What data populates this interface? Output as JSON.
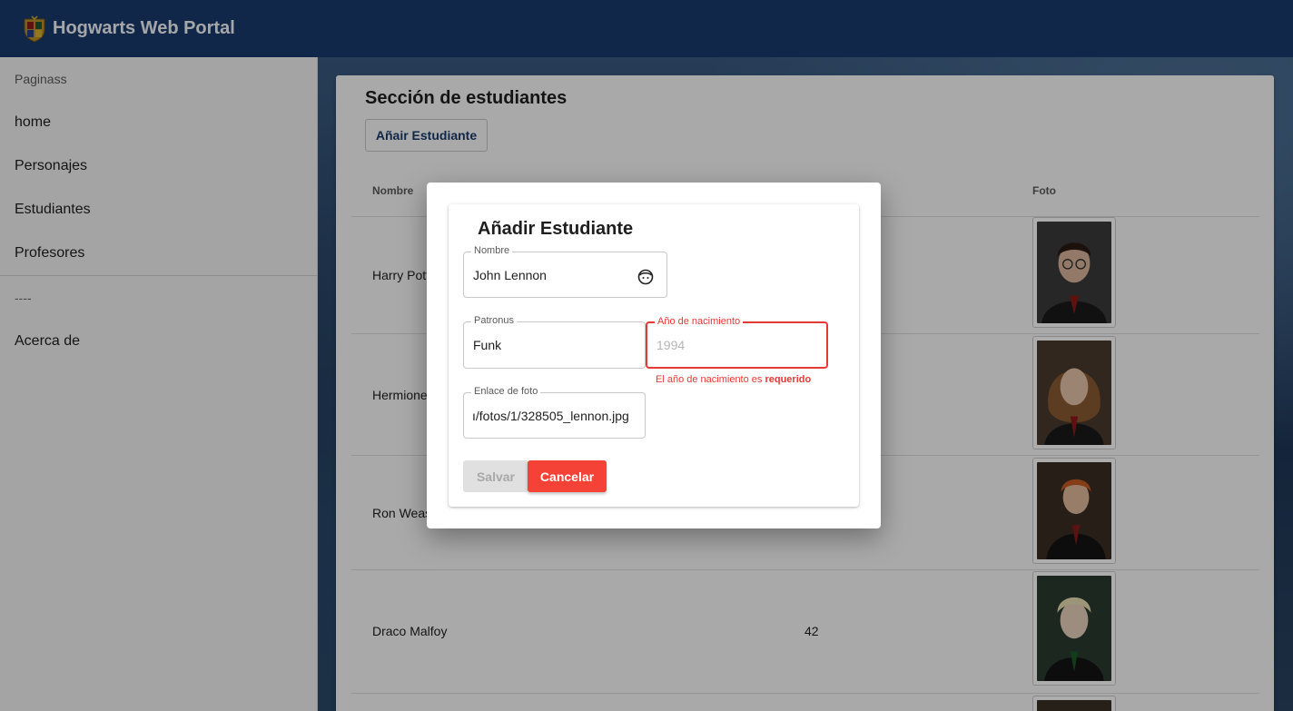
{
  "app": {
    "title": "Hogwarts Web Portal"
  },
  "sidebar": {
    "header": "Paginass",
    "items": [
      {
        "label": "home"
      },
      {
        "label": "Personajes"
      },
      {
        "label": "Estudiantes"
      },
      {
        "label": "Profesores"
      }
    ],
    "separator_text": "----",
    "about": "Acerca de"
  },
  "main": {
    "section_title": "Sección de estudiantes",
    "add_button": "Añair Estudiante",
    "columns": {
      "name": "Nombre",
      "photo": "Foto"
    },
    "rows": [
      {
        "name": "Harry Pott",
        "age": ""
      },
      {
        "name": "Hermione",
        "age": ""
      },
      {
        "name": "Ron Weas",
        "age": ""
      },
      {
        "name": "Draco Malfoy",
        "age": "42"
      }
    ]
  },
  "dialog": {
    "title": "Añadir Estudiante",
    "nombre": {
      "label": "Nombre",
      "value": "John Lennon",
      "icon": "face-icon"
    },
    "patronus": {
      "label": "Patronus",
      "value": "Funk"
    },
    "anio": {
      "label": "Año de nacimiento",
      "value": "",
      "placeholder": "1994",
      "error_prefix": "El año de nacimiento es ",
      "error_strong": "requerido"
    },
    "foto": {
      "label": "Enlace de foto",
      "value": "ı/fotos/1/328505_lennon.jpg"
    },
    "save_label": "Salvar",
    "cancel_label": "Cancelar"
  },
  "colors": {
    "toolbar": "#1a3a6c",
    "error": "#e53935",
    "cancel": "#f44336"
  }
}
